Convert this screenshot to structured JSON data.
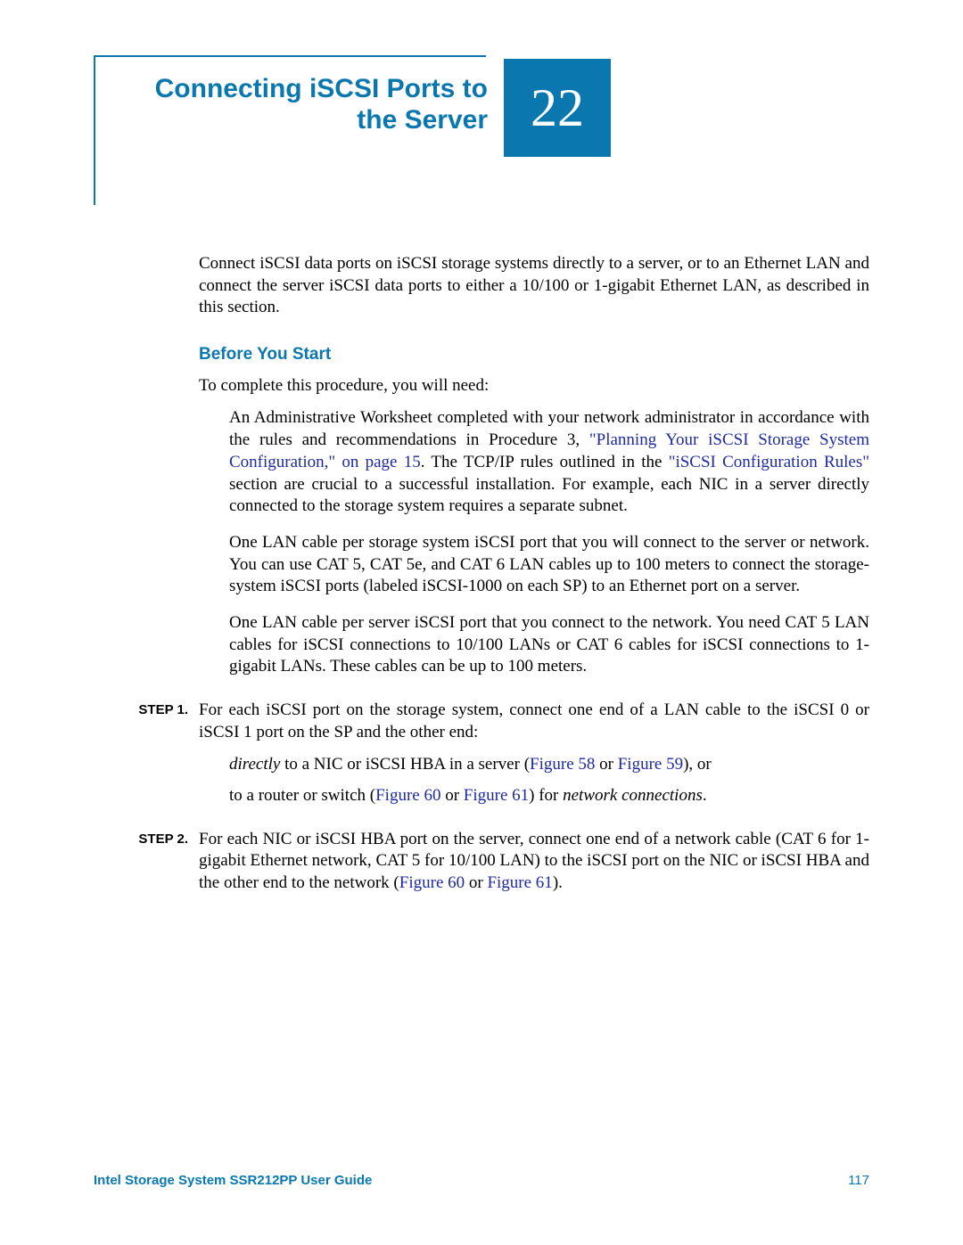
{
  "chapter": {
    "title": "Connecting iSCSI Ports to the Server",
    "number": "22"
  },
  "intro": "Connect iSCSI data ports on iSCSI storage systems directly to a server, or to an Ethernet LAN and connect the server iSCSI data ports to either a 10/100 or 1-gigabit Ethernet LAN, as described in this section.",
  "section": {
    "heading": "Before You Start",
    "lead": "To complete this procedure, you will need:",
    "req1_a": "An Administrative Worksheet completed with your network administrator in accordance with the rules and recommendations in Procedure 3, ",
    "req1_link1": "\"Planning Your iSCSI Storage System Configuration,\" on page 15",
    "req1_b": ". The TCP/IP rules outlined in the ",
    "req1_link2": "\"iSCSI Configuration Rules\"",
    "req1_c": " section are crucial to a successful installation. For example, each NIC in a server directly connected to the storage system requires a separate subnet.",
    "req2": "One LAN cable per storage system iSCSI port that you will connect to the server or network. You can use CAT 5, CAT 5e, and CAT 6 LAN cables up to 100 meters to connect the storage-system iSCSI ports (labeled iSCSI-1000 on each SP) to an Ethernet port on a server.",
    "req3": "One LAN cable per server iSCSI port that you connect to the network. You need CAT 5 LAN cables for iSCSI connections to 10/100 LANs or CAT 6 cables for iSCSI connections to 1-gigabit LANs. These cables can be up to 100 meters."
  },
  "steps": {
    "s1": {
      "label": "STEP 1.",
      "body": "For each iSCSI port on the storage system, connect one end of a LAN cable to the iSCSI 0 or iSCSI 1 port on the SP and the other end:",
      "sub1_a": "directly",
      "sub1_b": " to a NIC or iSCSI HBA in a server (",
      "sub1_link1": "Figure 58",
      "sub1_c": " or ",
      "sub1_link2": "Figure 59",
      "sub1_d": "), or",
      "sub2_a": "to a router or switch (",
      "sub2_link1": "Figure 60",
      "sub2_b": " or ",
      "sub2_link2": "Figure 61",
      "sub2_c": ") for ",
      "sub2_d": "network connections",
      "sub2_e": "."
    },
    "s2": {
      "label": "STEP 2.",
      "body_a": "For each NIC or iSCSI HBA port on the server, connect one end of a network cable (CAT 6 for 1-gigabit Ethernet network, CAT 5 for 10/100 LAN) to the iSCSI port on the NIC or iSCSI HBA and the other end to the network (",
      "body_link1": "Figure 60",
      "body_b": " or ",
      "body_link2": "Figure 61",
      "body_c": ")."
    }
  },
  "footer": {
    "title": "Intel Storage System SSR212PP User Guide",
    "page": "117"
  }
}
